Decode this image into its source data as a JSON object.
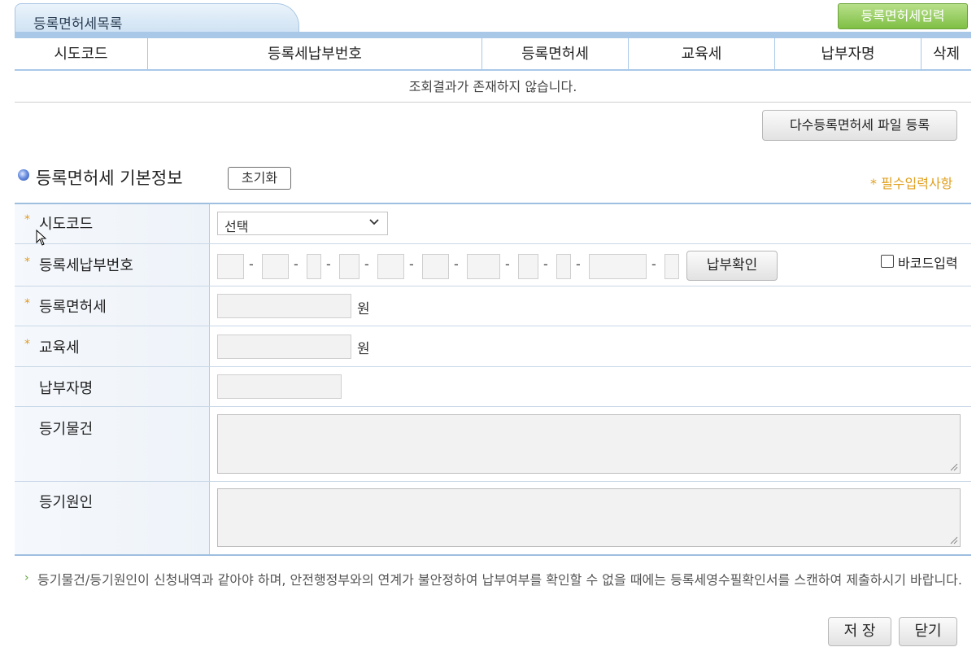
{
  "list": {
    "tab_title": "등록면허세목록",
    "add_button": "등록면허세입력",
    "columns": [
      "시도코드",
      "등록세납부번호",
      "등록면허세",
      "교육세",
      "납부자명",
      "삭제"
    ],
    "empty_message": "조회결과가 존재하지 않습니다.",
    "multi_upload_button": "다수등록면허세 파일 등록"
  },
  "form": {
    "section_title": "등록면허세 기본정보",
    "reset_button": "초기화",
    "required_note": "* 필수입력사항",
    "required_mark": "*",
    "fields": {
      "sido_code": {
        "label": "시도코드",
        "selected": "선택"
      },
      "pay_number": {
        "label": "등록세납부번호",
        "confirm_button": "납부확인",
        "barcode_label": "바코드입력",
        "separator": "-"
      },
      "license_tax": {
        "label": "등록면허세",
        "unit": "원"
      },
      "edu_tax": {
        "label": "교육세",
        "unit": "원"
      },
      "payer_name": {
        "label": "납부자명"
      },
      "registry_item": {
        "label": "등기물건"
      },
      "registry_cause": {
        "label": "등기원인"
      }
    }
  },
  "notice": {
    "marker": "›",
    "text": "등기물건/등기원인이 신청내역과 같아야 하며, 안전행정부와의 연계가 불안정하여 납부여부를 확인할 수 없을 때에는 등록세영수필확인서를 스캔하여 제출하시기 바랍니다."
  },
  "actions": {
    "save": "저 장",
    "close": "닫기"
  },
  "colors": {
    "header_blue": "#a9c8e8",
    "add_button_green": "#7fbf45",
    "required_orange": "#e0a020"
  }
}
